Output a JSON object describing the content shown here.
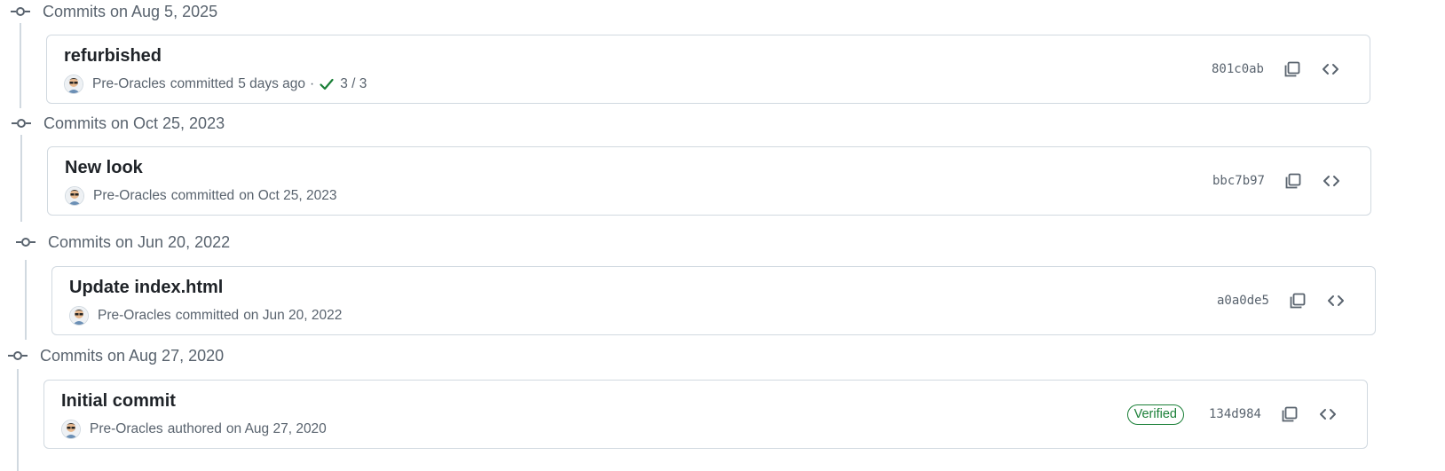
{
  "groups": [
    {
      "header": "Commits on Aug 5, 2025",
      "commit": {
        "title": "refurbished",
        "author": "Pre-Oracles",
        "verb": "committed",
        "when": "5 days ago",
        "separator": "·",
        "checks": "3 / 3",
        "check_color": "#1a7f37",
        "sha": "801c0ab",
        "copy_icon": "copy-icon",
        "code_icon": "code-icon"
      }
    },
    {
      "header": "Commits on Oct 25, 2023",
      "commit": {
        "title": "New look",
        "author": "Pre-Oracles",
        "verb": "committed",
        "when": "on Oct 25, 2023",
        "sha": "bbc7b97",
        "copy_icon": "copy-icon",
        "code_icon": "code-icon"
      }
    },
    {
      "header": "Commits on Jun 20, 2022",
      "commit": {
        "title": "Update index.html",
        "author": "Pre-Oracles",
        "verb": "committed",
        "when": "on Jun 20, 2022",
        "sha": "a0a0de5",
        "copy_icon": "copy-icon",
        "code_icon": "code-icon"
      }
    },
    {
      "header": "Commits on Aug 27, 2020",
      "commit": {
        "title": "Initial commit",
        "author": "Pre-Oracles",
        "verb": "authored",
        "when": "on Aug 27, 2020",
        "badge": "Verified",
        "badge_color": "#1a7f37",
        "sha": "134d984",
        "copy_icon": "copy-icon",
        "code_icon": "code-icon"
      }
    }
  ],
  "colors": {
    "border": "#d1d9e0",
    "muted_text": "#59636e",
    "title_text": "#1f2328",
    "success": "#1a7f37"
  }
}
